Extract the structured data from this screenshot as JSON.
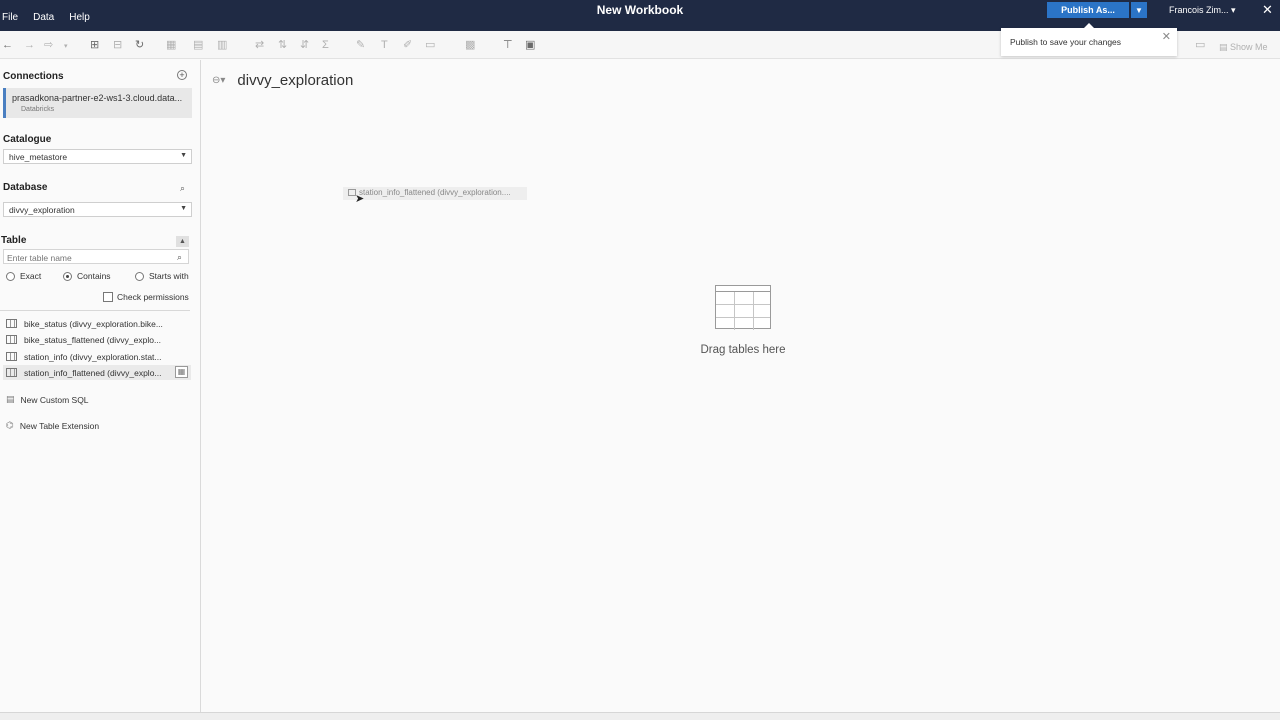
{
  "menu": {
    "items": [
      "File",
      "Data",
      "Help"
    ]
  },
  "window": {
    "title": "New Workbook"
  },
  "publish": {
    "label": "Publish As..."
  },
  "user": {
    "name": "Francois Zim..."
  },
  "toast": {
    "message": "Publish to save your changes"
  },
  "toolbar": {
    "show_me": "Show Me"
  },
  "sidebar": {
    "connections_title": "Connections",
    "connection": {
      "name": "prasadkona-partner-e2-ws1-3.cloud.data...",
      "type": "Databricks"
    },
    "catalogue_title": "Catalogue",
    "catalogue_value": "hive_metastore",
    "database_title": "Database",
    "database_value": "divvy_exploration",
    "table_title": "Table",
    "table_search_placeholder": "Enter table name",
    "match_options": [
      "Exact",
      "Contains",
      "Starts with"
    ],
    "check_permissions": "Check permissions",
    "tables": [
      "bike_status (divvy_exploration.bike...",
      "bike_status_flattened (divvy_explo...",
      "station_info (divvy_exploration.stat...",
      "station_info_flattened (divvy_explo..."
    ],
    "new_custom_sql": "New Custom SQL",
    "new_table_extension": "New Table Extension"
  },
  "canvas": {
    "title": "divvy_exploration",
    "drag_ghost": "station_info_flattened (divvy_exploration....",
    "drop_hint": "Drag tables here"
  }
}
